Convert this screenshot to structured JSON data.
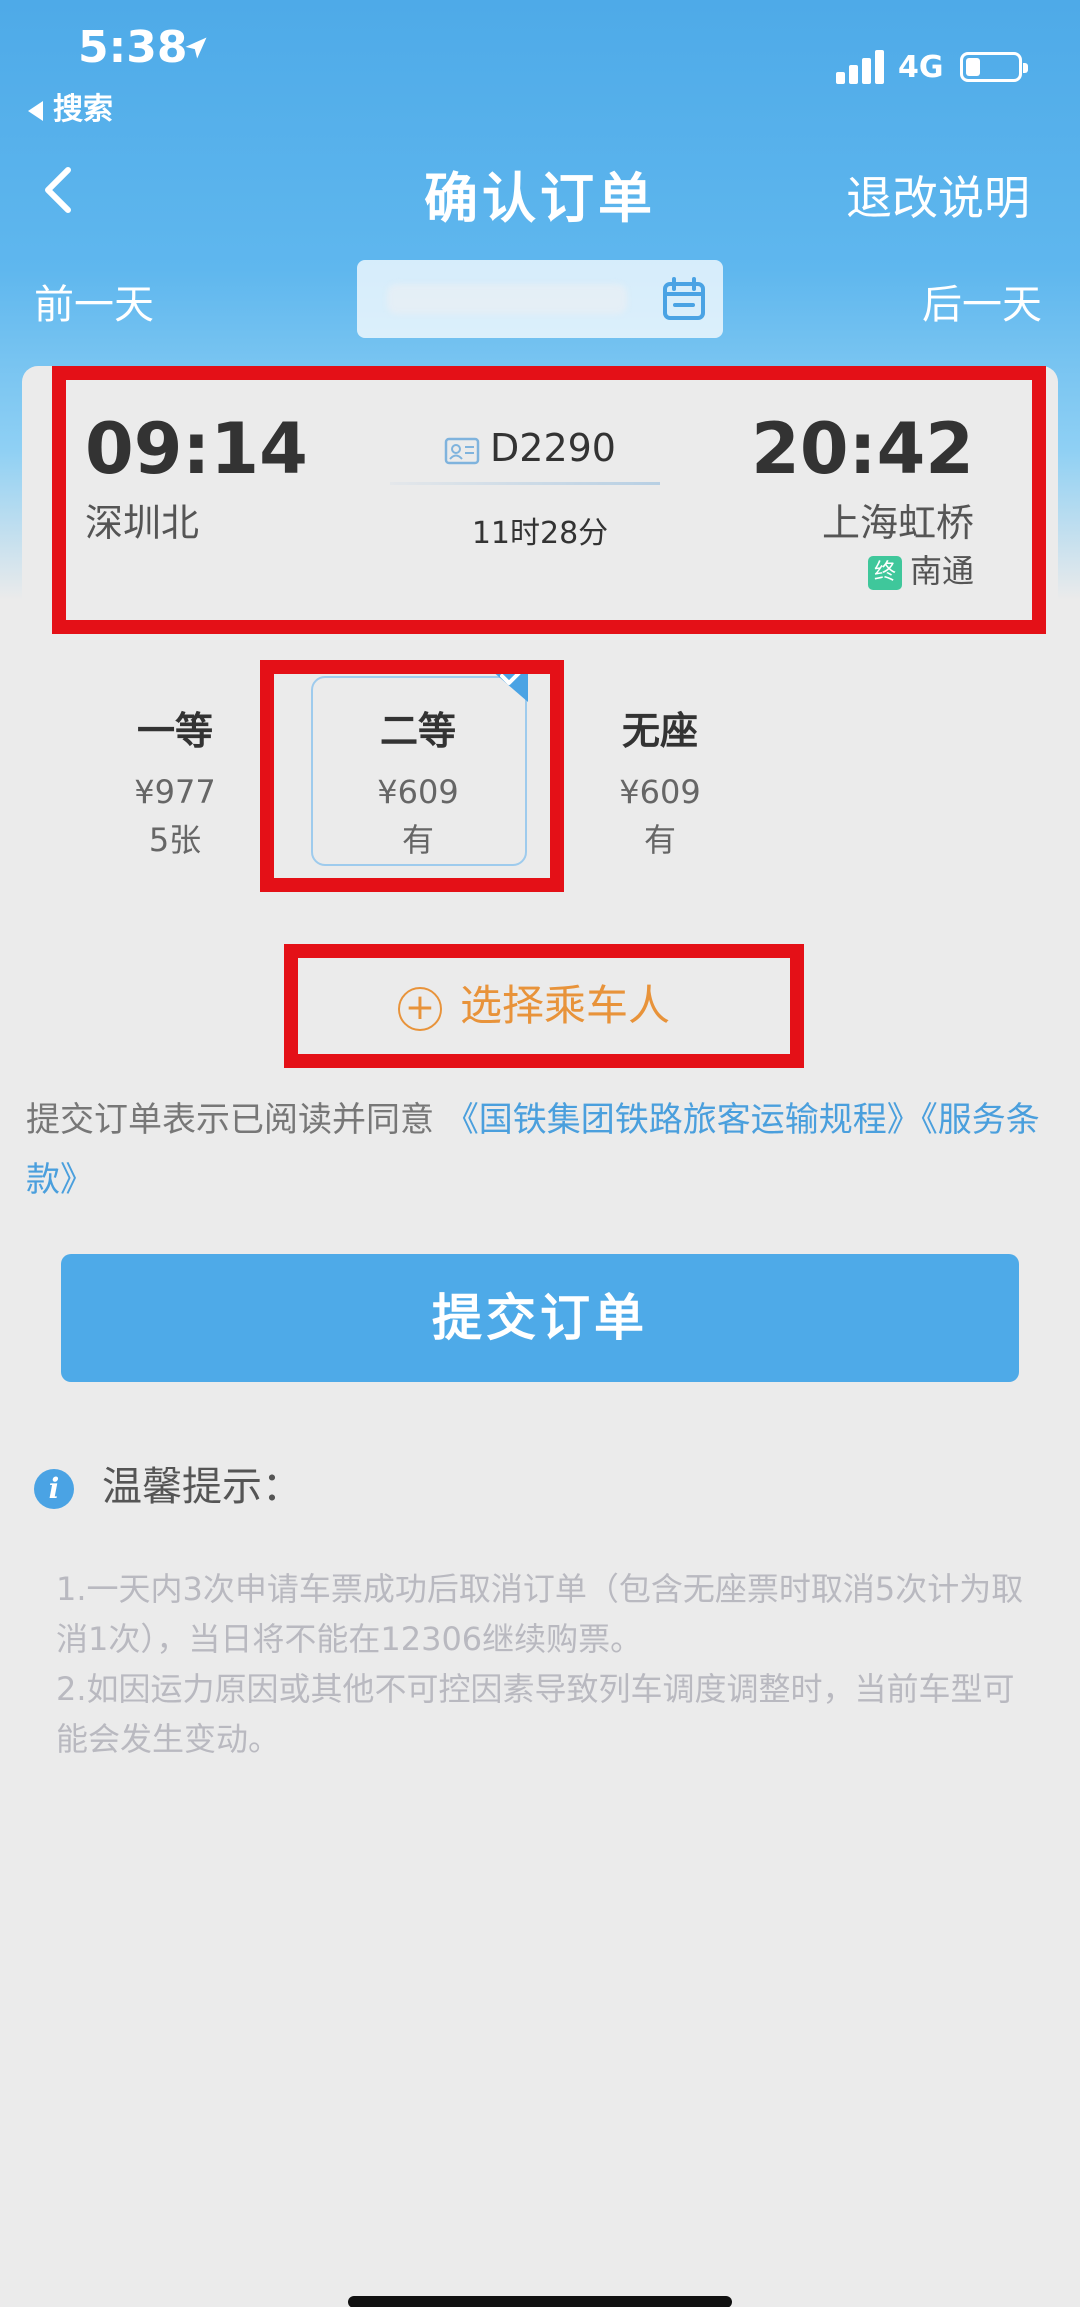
{
  "status_bar": {
    "time": "5:38",
    "back_app": "搜索",
    "network": "4G"
  },
  "nav": {
    "title": "确认订单",
    "right_link": "退改说明"
  },
  "day_bar": {
    "prev": "前一天",
    "next": "后一天"
  },
  "train": {
    "departure_time": "09:14",
    "departure_station": "深圳北",
    "train_number": "D2290",
    "duration": "11时28分",
    "arrival_time": "20:42",
    "arrival_station": "上海虹桥",
    "terminal_badge": "终",
    "terminal_station": "南通"
  },
  "seats": [
    {
      "name": "一等",
      "price": "¥977",
      "availability": "5张"
    },
    {
      "name": "二等",
      "price": "¥609",
      "availability": "有"
    },
    {
      "name": "无座",
      "price": "¥609",
      "availability": "有"
    }
  ],
  "selected_seat": "二等",
  "add_passenger_label": "选择乘车人",
  "agreement": {
    "text": "提交订单表示已阅读并同意",
    "link1": "《国铁集团铁路旅客运输规程》",
    "link2": "《服务条款》"
  },
  "submit_label": "提交订单",
  "tips": {
    "title": "温馨提示：",
    "lines": [
      "1.一天内3次申请车票成功后取消订单（包含无座票时取消5次计为取消1次），当日将不能在12306继续购票。",
      "2.如因运力原因或其他不可控因素导致列车调度调整时，当前车型可能会发生变动。"
    ]
  },
  "colors": {
    "brand_blue": "#4eaae8",
    "highlight_red": "#e41017",
    "accent_orange": "#e8933a",
    "terminal_green": "#3fc79b",
    "link_blue": "#4a9fdd"
  }
}
